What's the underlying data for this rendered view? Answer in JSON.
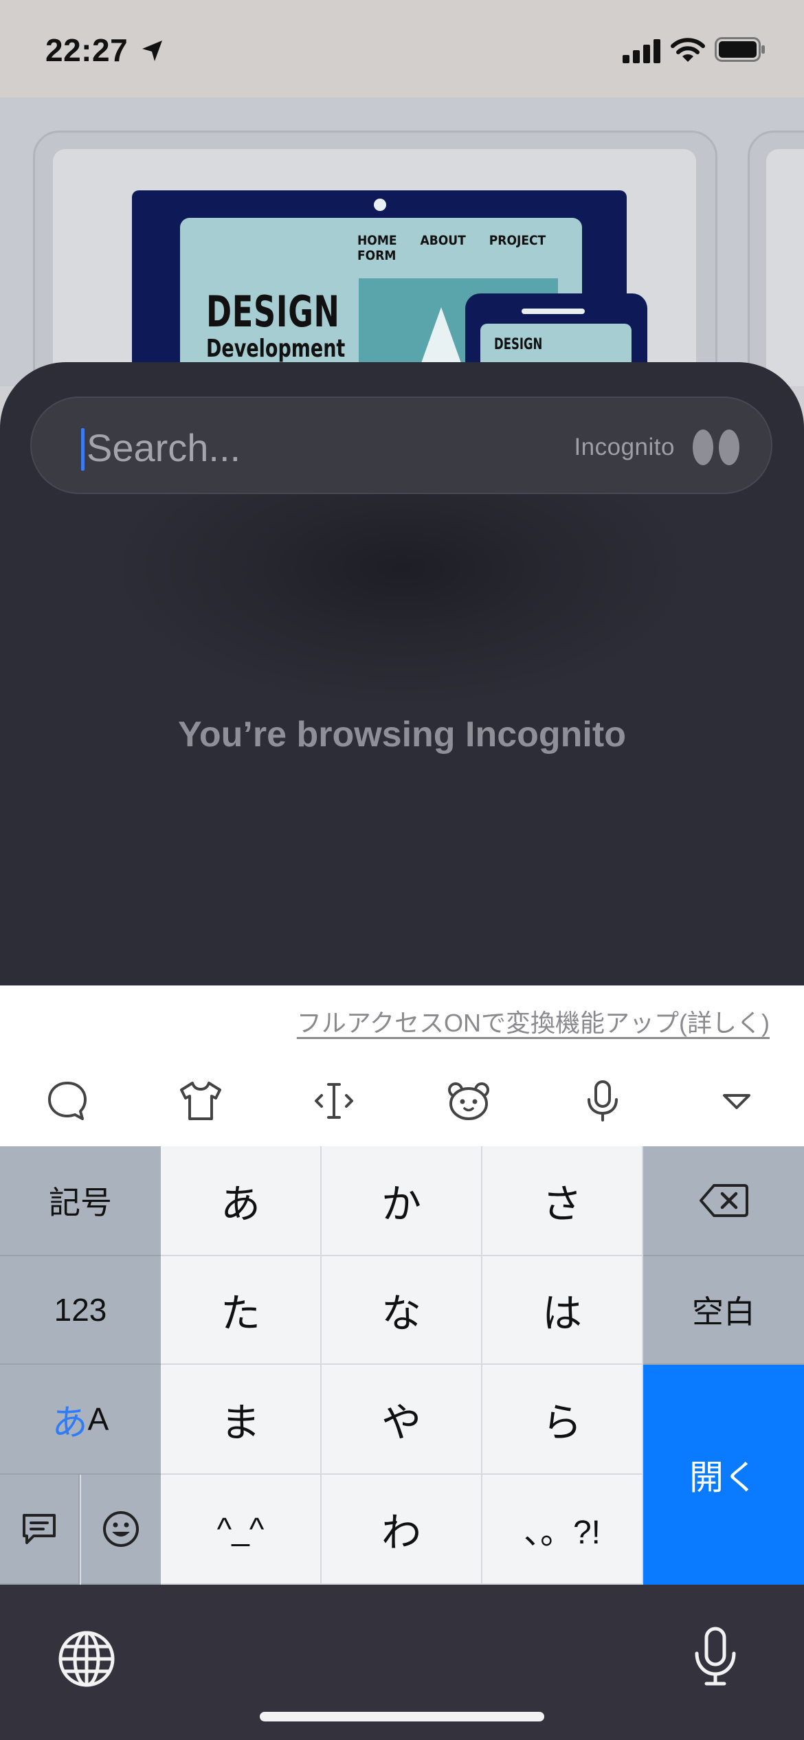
{
  "status_bar": {
    "time": "22:27"
  },
  "background_tab": {
    "nav": [
      "HOME",
      "ABOUT",
      "PROJECT",
      "FORM"
    ],
    "headline": "DESIGN",
    "subheadline": "Development",
    "tablet_headline": "DESIGN"
  },
  "search": {
    "placeholder": "Search...",
    "mode_label": "Incognito"
  },
  "main": {
    "message": "You’re browsing Incognito"
  },
  "keyboard": {
    "full_access_link": "フルアクセスONで変換機能アップ(詳しく)",
    "toolbar_icons": [
      "chat-bubble-icon",
      "shirt-icon",
      "cursor-move-icon",
      "bear-face-icon",
      "microphone-icon",
      "collapse-triangle-icon"
    ],
    "keys": {
      "kigou": "記号",
      "num": "123",
      "kana_a": "あ",
      "kana_A": "A",
      "a": "あ",
      "ka": "か",
      "sa": "さ",
      "ta": "た",
      "na": "な",
      "ha": "は",
      "ma": "ま",
      "ya": "や",
      "ra": "ら",
      "face": "^_^",
      "wa": "わ",
      "punct": "、。?!",
      "space": "空白",
      "open": "開く"
    },
    "accent_color": "#0a7aff"
  }
}
